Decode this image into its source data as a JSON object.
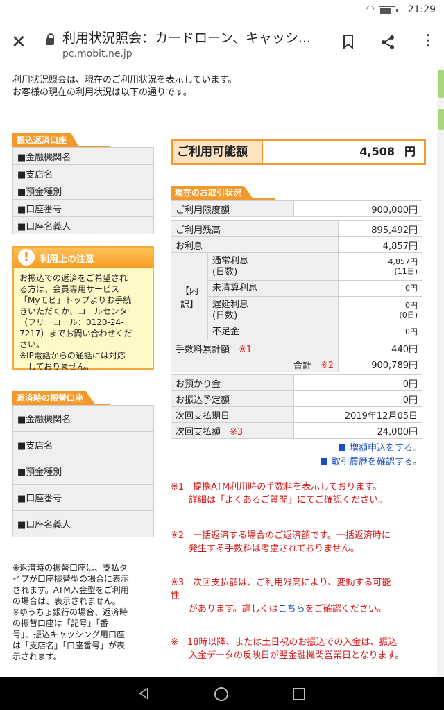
{
  "status": {
    "time": "21:29"
  },
  "browser": {
    "title": "利用状況照会：カードローン、キャッシ...",
    "domain": "pc.mobit.ne.jp"
  },
  "intro": {
    "line1": "利用状況照会は、現在のご利用状況を表示しています。",
    "line2": "お客様の現在の利用状況は以下の通りです。"
  },
  "repay_account": {
    "title": "振込返済口座",
    "rows": [
      "■金融機関名",
      "■支店名",
      "■預金種別",
      "■口座番号",
      "■口座名義人"
    ]
  },
  "notice": {
    "title": "利用上の注意",
    "lines": [
      "お振込での返済をご希望され",
      "る方は、会員専用サービス",
      "「Myモビ」トップよりお手続",
      "きいただくか、コールセンター",
      "（フリーコール：0120-24-",
      "7217）までお問い合わせくだ",
      "さい。",
      "※IP電話からの通話には対応",
      "　しておりません。"
    ]
  },
  "transfer_account": {
    "title": "返済時の振替口座",
    "rows": [
      "■金融機関名",
      "■支店名",
      "■預金種別",
      "■口座番号",
      "■口座名義人"
    ]
  },
  "left_note": {
    "lines": [
      "※返済時の振替口座は、支払タ",
      "イプが口座振替型の場合に表示",
      "されます。ATM入金型をご利用",
      "の場合は、表示されません。",
      "※ゆうちょ銀行の場合、返済時",
      "の振替口座は「記号」「番",
      "号」、振込キャッシング用口座",
      "は「支店名」「口座番号」が表",
      "示されます。"
    ]
  },
  "available": {
    "label": "ご利用可能額",
    "value": "4,508",
    "unit": "円"
  },
  "status_section": {
    "title": "現在のお取引状況"
  },
  "table": {
    "limit_label": "ご利用限度額",
    "limit_value": "900,000円",
    "balance_label": "ご利用残高",
    "balance_value": "895,492円",
    "interest_label": "お利息",
    "interest_value": "4,857円",
    "breakdown_label": "【内訳】",
    "normal_label": "通常利息\n(日数)",
    "normal_value": "4,857円\n(11日)",
    "unsettled_label": "未清算利息",
    "unsettled_value": "0円",
    "late_label": "遅延利息\n(日数)",
    "late_value": "0円\n(0日)",
    "shortage_label": "不足金",
    "shortage_value": "0円",
    "fee_label": "手数料累計額",
    "fee_mark": "※1",
    "fee_value": "440円",
    "total_label": "合計",
    "total_mark": "※2",
    "total_value": "900,789円",
    "deposit_label": "お預かり金",
    "deposit_value": "0円",
    "scheduled_label": "お振込予定額",
    "scheduled_value": "0円",
    "next_date_label": "次回支払期日",
    "next_date_value": "2019年12月05日",
    "next_amount_label": "次回支払額",
    "next_amount_mark": "※3",
    "next_amount_value": "24,000円"
  },
  "links": {
    "increase": "増額申込をする。",
    "history": "取引履歴を確認する。"
  },
  "notes": {
    "n1a": "※1　提携ATM利用時の手数料を表示しております。",
    "n1b": "　　詳細は「よくあるご質問」にてご確認ください。",
    "n2a": "※2　一括返済する場合のご返済額です。一括返済時に",
    "n2b": "　　発生する手数料は考慮されておりません。",
    "n3a": "※3　次回支払額は、ご利用残高により、変動する可能",
    "n3b": "性",
    "n3c_pre": "　　があります。詳しくは",
    "n3c_link": "こちら",
    "n3c_post": "をご確認ください。",
    "n4a": "※　18時以降、または土日祝のお振込での入金は、振込",
    "n4b": "　　入金データの反映日が翌金融機関営業日となります。"
  }
}
